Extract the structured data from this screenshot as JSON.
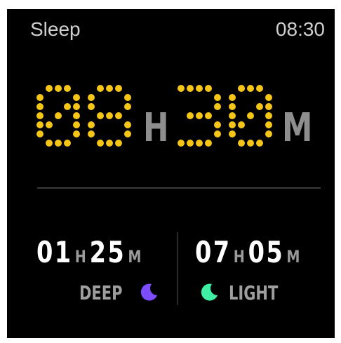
{
  "header": {
    "title": "Sleep",
    "time": "08:30"
  },
  "total": {
    "hours": "08",
    "hours_unit": "H",
    "minutes": "30",
    "minutes_unit": "M",
    "digit_color": "#f5c518"
  },
  "deep": {
    "hours": "01",
    "hours_unit": "H",
    "minutes": "25",
    "minutes_unit": "M",
    "label": "DEEP",
    "icon": "moon-icon",
    "icon_color": "#7b4dff"
  },
  "light": {
    "hours": "07",
    "hours_unit": "H",
    "minutes": "05",
    "minutes_unit": "M",
    "label": "LIGHT",
    "icon": "moon-icon",
    "icon_color": "#3ff0a4"
  }
}
